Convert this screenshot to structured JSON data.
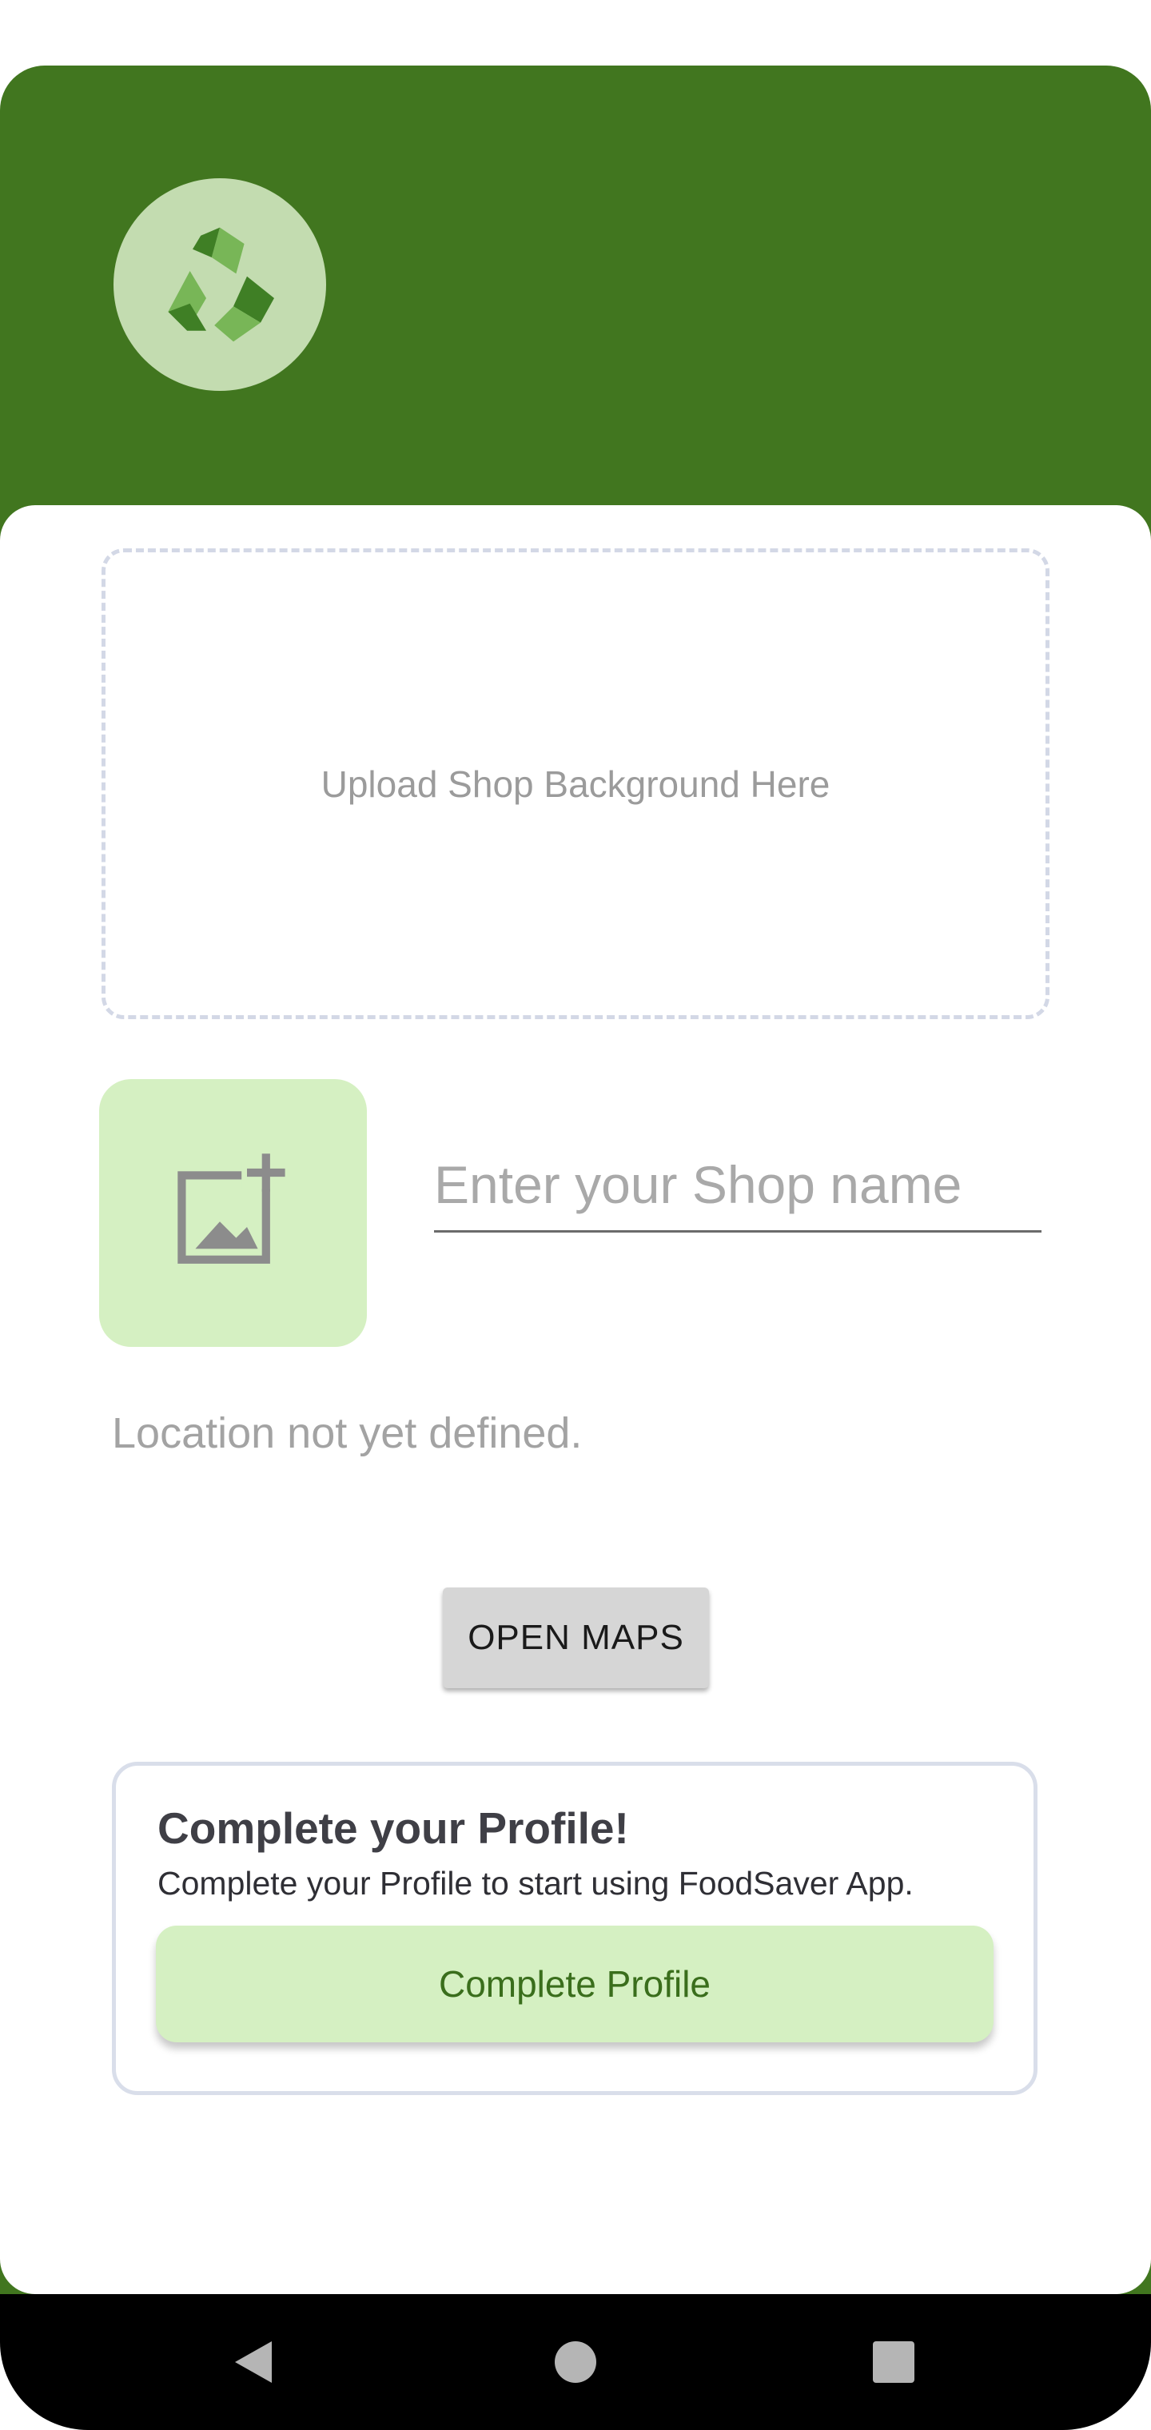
{
  "colors": {
    "header_green": "#41761f",
    "light_green": "#d5f0c2",
    "button_text_green": "#3a6e1c"
  },
  "upload": {
    "label": "Upload Shop Background Here"
  },
  "shop_name": {
    "placeholder": "Enter your Shop name",
    "value": ""
  },
  "location": {
    "status_text": "Location not yet defined."
  },
  "maps_button": {
    "label": "OPEN MAPS"
  },
  "profile_card": {
    "title": "Complete your Profile!",
    "subtitle": "Complete your Profile to start using FoodSaver App.",
    "button_label": "Complete Profile"
  },
  "icons": {
    "logo": "recycle-icon",
    "add_image": "add-photo-icon",
    "nav_back": "back-triangle-icon",
    "nav_home": "home-circle-icon",
    "nav_recents": "recents-square-icon"
  }
}
